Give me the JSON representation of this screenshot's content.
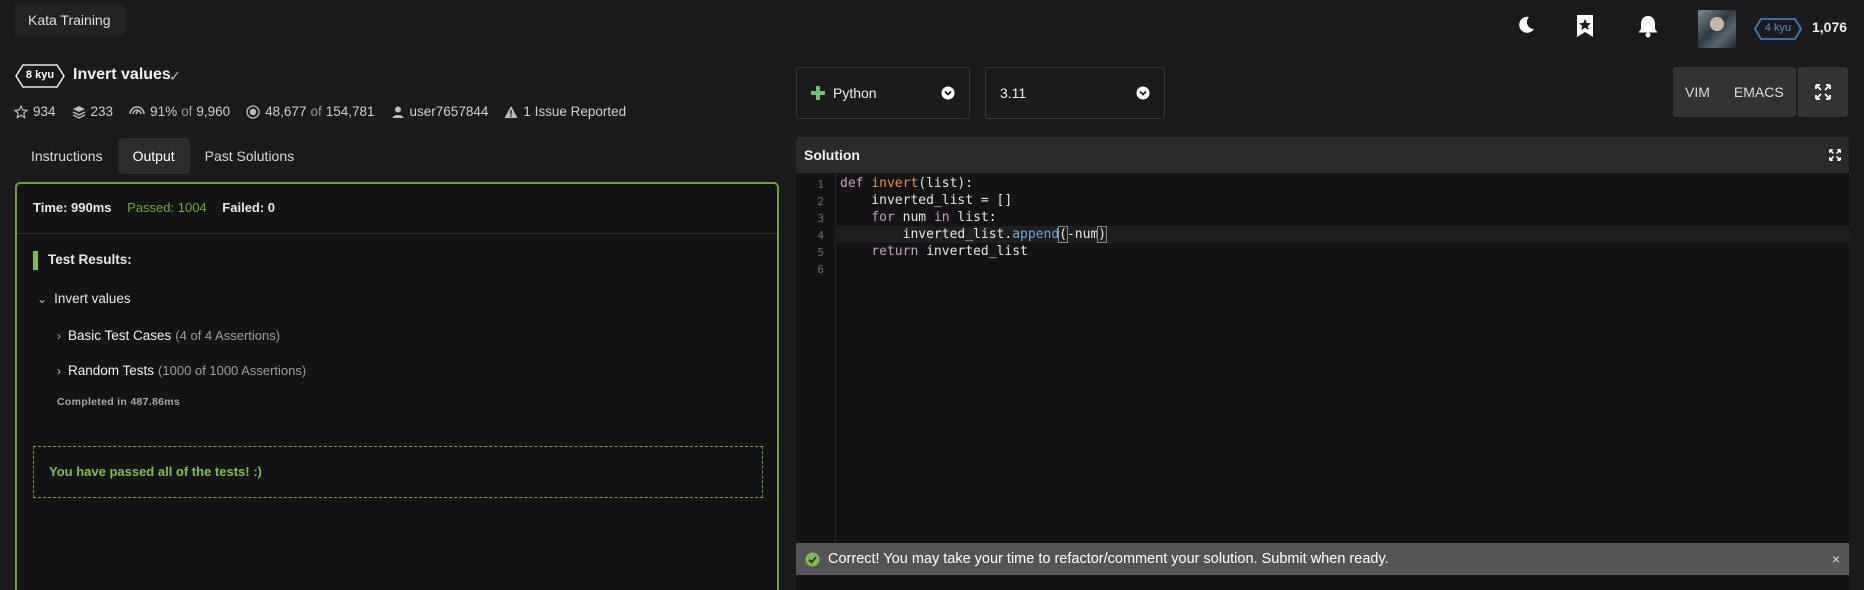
{
  "topbar": {
    "kata_training": "Kata Training",
    "user_rank": "4 kyu",
    "honor": "1,076",
    "icons": [
      "moon-icon",
      "bookmark-star-icon",
      "bell-icon",
      "avatar"
    ]
  },
  "kata": {
    "rank": "8 kyu",
    "title": "Invert values",
    "check": "✓",
    "stats": {
      "stars": "934",
      "collections": "233",
      "satisfaction_pct": "91%",
      "satisfaction_of": "of",
      "satisfaction_votes": "9,960",
      "completed": "48,677",
      "completed_of": "of",
      "attempts": "154,781",
      "author": "user7657844",
      "issues": "1 Issue Reported"
    }
  },
  "tabs": [
    "Instructions",
    "Output",
    "Past Solutions"
  ],
  "output": {
    "time": "Time: 990ms",
    "passed": "Passed: 1004",
    "failed": "Failed: 0",
    "test_results_label": "Test Results:",
    "group_name": "Invert values",
    "cases": [
      {
        "name": "Basic Test Cases",
        "assertions": "(4 of 4 Assertions)"
      },
      {
        "name": "Random Tests",
        "assertions": "(1000 of 1000 Assertions)"
      }
    ],
    "completed_in": "Completed in 487.86ms",
    "pass_message": "You have passed all of the tests! :)"
  },
  "editor": {
    "language": "Python",
    "version": "3.11",
    "modes": [
      "VIM",
      "EMACS"
    ],
    "solution_label": "Solution",
    "line_numbers": [
      "1",
      "2",
      "3",
      "4",
      "5",
      "6"
    ],
    "code": {
      "l1_kw": "def",
      "l1_fn": "invert",
      "l1_rest": "(list):",
      "l2": "    inverted_list = []",
      "l3_indent": "    ",
      "l3_for": "for",
      "l3_mid": " num ",
      "l3_in": "in",
      "l3_rest": " list:",
      "l4_pre": "        inverted_list.",
      "l4_method": "append",
      "l4_open": "(",
      "l4_arg": "-num",
      "l4_close": ")",
      "l5_indent": "    ",
      "l5_kw": "return",
      "l5_rest": " inverted_list"
    }
  },
  "toast": {
    "message": "Correct! You may take your time to refactor/comment your solution. Submit when ready.",
    "close": "×"
  },
  "colors": {
    "success_green": "#6aaa3c",
    "rank_blue": "#3c7ebb",
    "background": "#1b1b1d"
  }
}
